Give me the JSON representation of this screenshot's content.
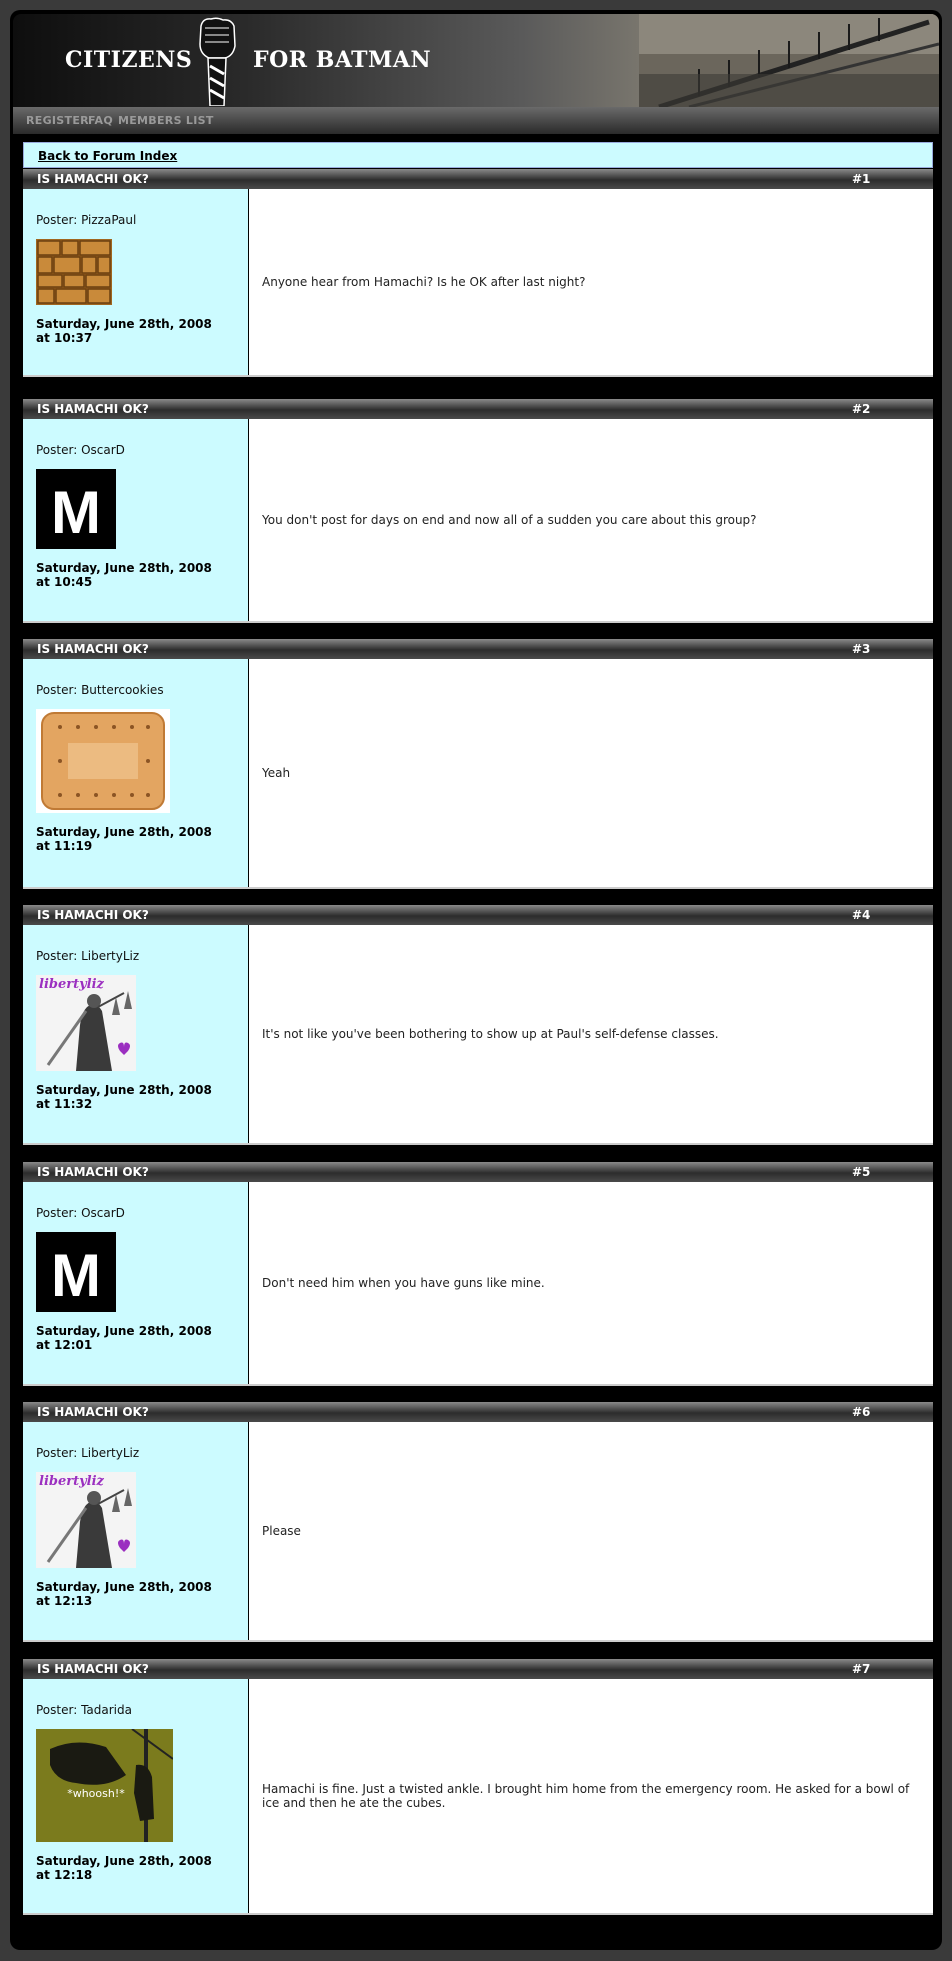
{
  "site": {
    "title_left": "CITIZENS",
    "title_right": "FOR BATMAN"
  },
  "nav": {
    "items": [
      "REGISTER",
      "FAQ",
      "MEMBERS LIST"
    ]
  },
  "back_link": "Back to Forum Index",
  "posts": [
    {
      "subject": "IS HAMACHI OK?",
      "number": "#1",
      "poster": "Poster: PizzaPaul",
      "avatar": "pizza-texture-avatar",
      "date_line1": "Saturday, June 28th, 2008",
      "date_line2": "at 10:37",
      "message": "Anyone hear from Hamachi? Is he OK after last night?"
    },
    {
      "subject": "IS HAMACHI OK?",
      "number": "#2",
      "poster": "Poster: OscarD",
      "avatar": "letter-m-avatar",
      "avatar_letter": "M",
      "date_line1": "Saturday, June 28th, 2008",
      "date_line2": "at 10:45",
      "message": "You don't post for days on end and now all of a sudden you care about this group?"
    },
    {
      "subject": "IS HAMACHI OK?",
      "number": "#3",
      "poster": "Poster: Buttercookies",
      "avatar": "butter-cookie-avatar",
      "date_line1": "Saturday, June 28th, 2008",
      "date_line2": "at 11:19",
      "message": "Yeah"
    },
    {
      "subject": "IS HAMACHI OK?",
      "number": "#4",
      "poster": "Poster: LibertyLiz",
      "avatar": "lady-justice-avatar",
      "avatar_text": "libertyliz",
      "date_line1": "Saturday, June 28th, 2008",
      "date_line2": "at 11:32",
      "message": "It's not like you've been bothering to show up at Paul's self-defense classes."
    },
    {
      "subject": "IS HAMACHI OK?",
      "number": "#5",
      "poster": "Poster: OscarD",
      "avatar": "letter-m-avatar",
      "avatar_letter": "M",
      "date_line1": "Saturday, June 28th, 2008",
      "date_line2": "at 12:01",
      "message": "Don't need him when you have guns like mine."
    },
    {
      "subject": "IS HAMACHI OK?",
      "number": "#6",
      "poster": "Poster: LibertyLiz",
      "avatar": "lady-justice-avatar",
      "avatar_text": "libertyliz",
      "date_line1": "Saturday, June 28th, 2008",
      "date_line2": "at 12:13",
      "message": "Please"
    },
    {
      "subject": "IS HAMACHI OK?",
      "number": "#7",
      "poster": "Poster: Tadarida",
      "avatar": "whoosh-bat-avatar",
      "avatar_text": "*whoosh!*",
      "date_line1": "Saturday, June 28th, 2008",
      "date_line2": "at 12:18",
      "message": "Hamachi is fine. Just a twisted ankle. I brought him home from the emergency room. He asked for a bowl of ice and then he ate the cubes."
    }
  ],
  "colors": {
    "poster_panel": "#ccfbff",
    "frame": "#000000",
    "avatar_purple": "#9b2fc0"
  }
}
